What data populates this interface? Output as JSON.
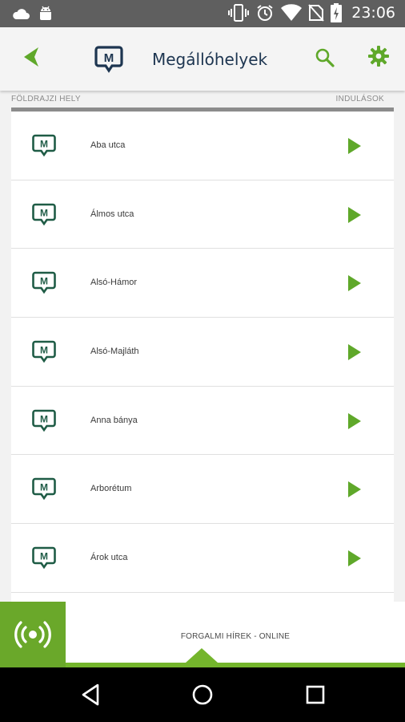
{
  "status_bar": {
    "time": "23:06",
    "icons": [
      "cloud-icon",
      "android-icon",
      "vibrate-icon",
      "alarm-icon",
      "wifi-icon",
      "no-sim-icon",
      "battery-charging-icon"
    ]
  },
  "app_bar": {
    "title": "Megállóhelyek",
    "back_icon": "back-arrow-icon",
    "logo_icon": "m-stop-logo-icon",
    "search_icon": "search-icon",
    "settings_icon": "gear-icon"
  },
  "list_header": {
    "left": "FÖLDRAJZI HELY",
    "right": "INDULÁSOK"
  },
  "stops": [
    {
      "name": "Aba utca"
    },
    {
      "name": "Álmos utca"
    },
    {
      "name": "Alsó-Hámor"
    },
    {
      "name": "Alsó-Majláth"
    },
    {
      "name": "Anna bánya"
    },
    {
      "name": "Arborétum"
    },
    {
      "name": "Árok utca"
    },
    {
      "name": ""
    }
  ],
  "news_bar": {
    "label": "FORGALMI HÍREK - ONLINE",
    "icon": "radio-broadcast-icon"
  },
  "colors": {
    "accent_green": "#6aa82a",
    "stop_icon_green": "#1f5c46",
    "title_navy": "#1d3550",
    "status_bar": "#5f5f5f"
  }
}
